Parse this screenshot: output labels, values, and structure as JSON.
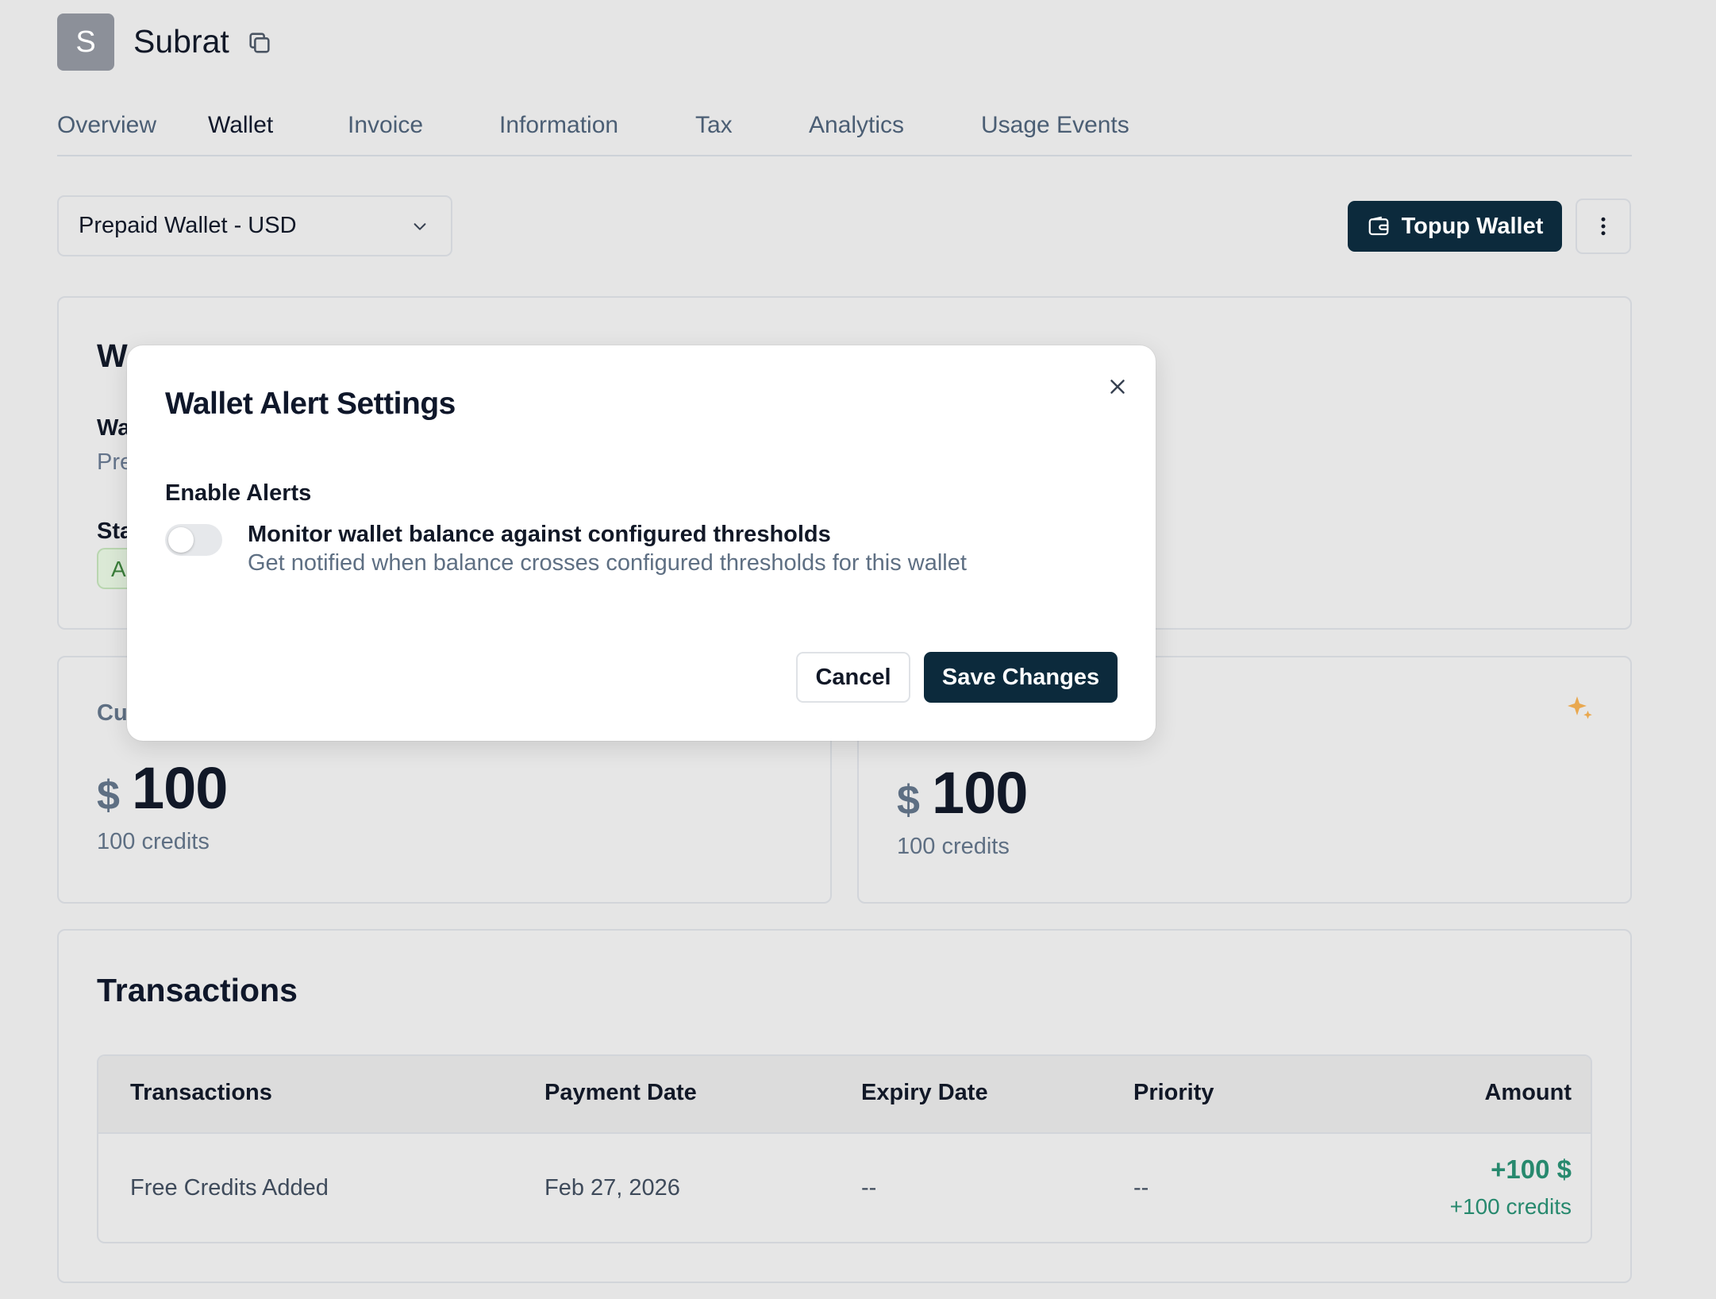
{
  "header": {
    "avatar_initial": "S",
    "customer_name": "Subrat",
    "copy_icon": "copy-icon"
  },
  "tabs": [
    {
      "label": "Overview",
      "active": false
    },
    {
      "label": "Wallet",
      "active": true
    },
    {
      "label": "Invoice",
      "active": false
    },
    {
      "label": "Information",
      "active": false
    },
    {
      "label": "Tax",
      "active": false
    },
    {
      "label": "Analytics",
      "active": false
    },
    {
      "label": "Usage Events",
      "active": false
    }
  ],
  "wallet_select": {
    "selected": "Prepaid Wallet - USD",
    "icon": "chevron-down-icon"
  },
  "actions": {
    "topup_label": "Topup Wallet",
    "topup_icon": "wallet-icon",
    "more_icon": "more-vertical-icon"
  },
  "info_card": {
    "title_peek": "W",
    "wallet_label_peek": "Wa",
    "wallet_value_peek": "Pre",
    "status_label_peek": "Sta",
    "status_badge_peek": "A"
  },
  "balances": {
    "left": {
      "label_peek": "Cu",
      "currency": "$",
      "amount": "100",
      "credits": "100 credits"
    },
    "right": {
      "currency": "$",
      "amount": "100",
      "credits": "100 credits",
      "icon": "sparkle-icon"
    }
  },
  "transactions": {
    "title": "Transactions",
    "columns": [
      "Transactions",
      "Payment Date",
      "Expiry Date",
      "Priority",
      "Amount"
    ],
    "rows": [
      {
        "name": "Free Credits Added",
        "payment_date": "Feb 27, 2026",
        "expiry_date": "--",
        "priority": "--",
        "amount": "+100 $",
        "credits": "+100 credits"
      }
    ]
  },
  "modal": {
    "title": "Wallet Alert Settings",
    "close_icon": "close-icon",
    "enable_label": "Enable Alerts",
    "toggle_on": false,
    "toggle_title": "Monitor wallet balance against configured thresholds",
    "toggle_description": "Get notified when balance crosses configured thresholds for this wallet",
    "cancel_label": "Cancel",
    "save_label": "Save Changes"
  },
  "colors": {
    "primary": "#0c2a3c",
    "positive": "#27896e",
    "accent_sparkle": "#e9a84f"
  }
}
